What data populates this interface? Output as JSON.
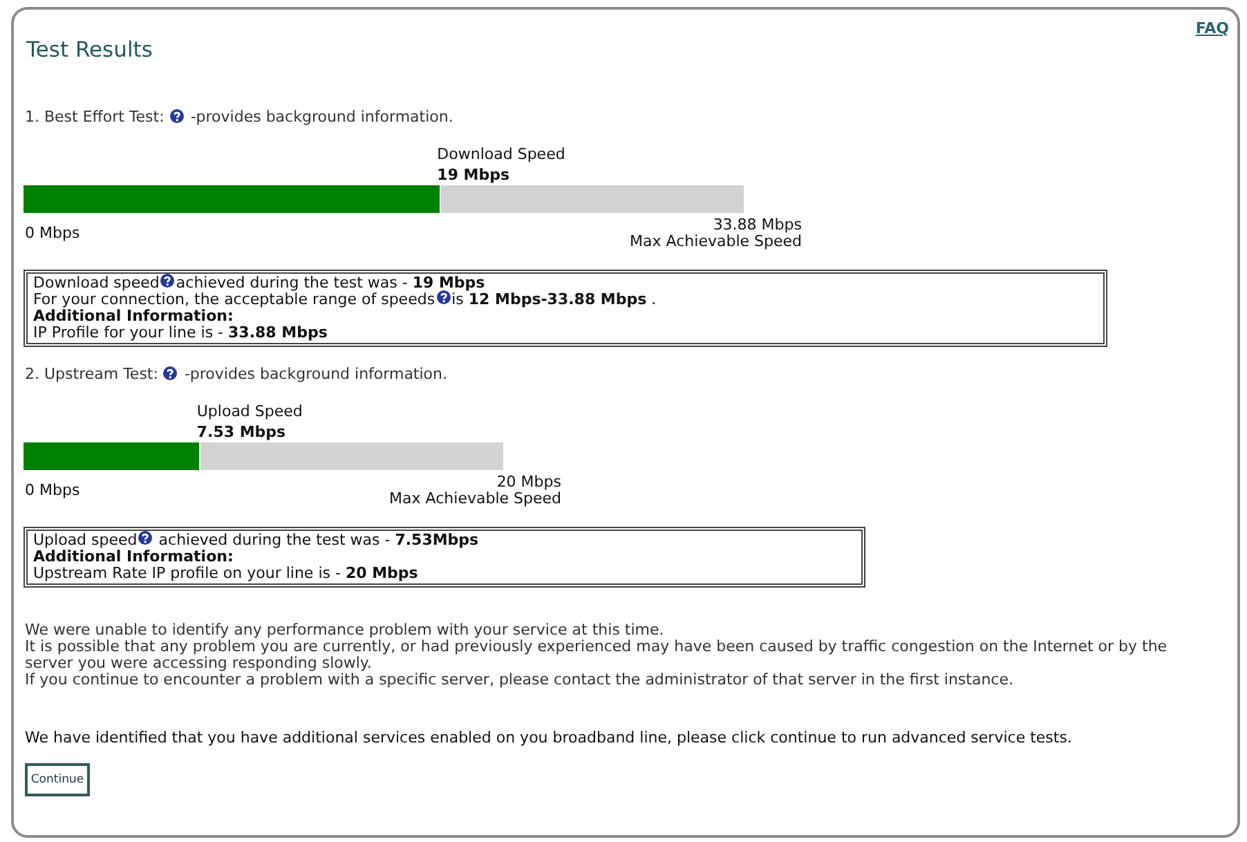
{
  "faq_link": "FAQ",
  "title": "Test Results",
  "tests": [
    {
      "label": "1. Best Effort Test:",
      "help_note": "-provides background information.",
      "meter": {
        "caption": "Download Speed",
        "reading": "19 Mbps",
        "level": 0.58,
        "min_label": "0 Mbps",
        "max_value": "33.88 Mbps",
        "max_caption": "Max Achievable Speed"
      },
      "details": [
        {
          "kind": "help_text",
          "text": "Download speed",
          "continuation": "achieved during the test was - **19 Mbps**"
        },
        {
          "kind": "help_text",
          "text": "For your connection, the acceptable range of speeds",
          "continuation": "is **12 Mbps-33.88 Mbps** ."
        },
        {
          "kind": "heading",
          "text": "Additional Information:"
        },
        {
          "kind": "text",
          "text": "IP Profile for your line is - **33.88 Mbps**"
        }
      ]
    },
    {
      "label": "2. Upstream Test:",
      "help_note": "-provides background information.",
      "meter": {
        "caption": "Upload Speed",
        "reading": "7.53 Mbps",
        "level": 0.37,
        "min_label": "0 Mbps",
        "max_value": "20 Mbps",
        "max_caption": "Max Achievable Speed"
      },
      "details": [
        {
          "kind": "help_text",
          "text": "Upload speed",
          "continuation": " achieved during the test was - **7.53Mbps**"
        },
        {
          "kind": "heading",
          "text": "Additional Information:"
        },
        {
          "kind": "text",
          "text": "Upstream Rate IP profile on your line is - **20 Mbps**"
        }
      ]
    }
  ],
  "notes": [
    "We were unable to identify any performance problem with your service at this time.",
    "It is possible that any problem you are currently, or had previously experienced may have been caused by traffic congestion on the Internet or by the server you were accessing responding slowly.",
    "If you continue to encounter a problem with a specific server, please contact the administrator of that server in the first instance."
  ],
  "services_note": "We have identified that you have additional services enabled on you broadband line, please click continue to run advanced service tests.",
  "continue_button": "Continue"
}
